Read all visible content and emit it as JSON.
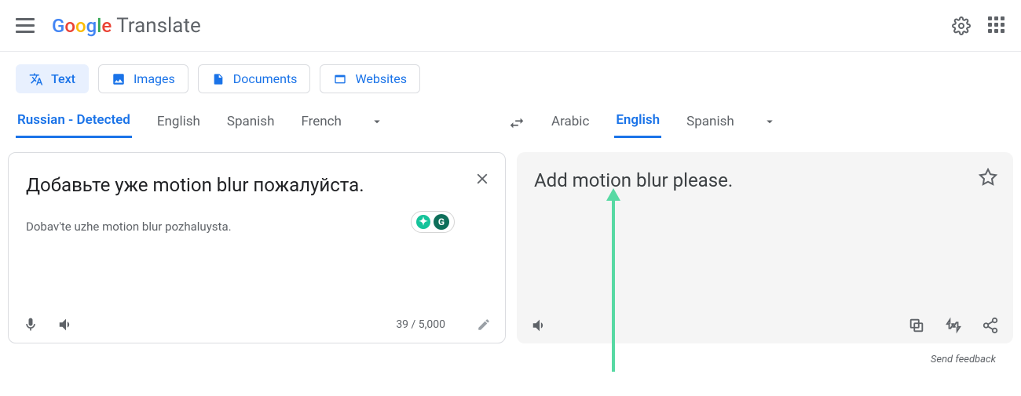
{
  "header": {
    "logo_translate": "Translate"
  },
  "modes": {
    "text": "Text",
    "images": "Images",
    "documents": "Documents",
    "websites": "Websites"
  },
  "source_langs": {
    "detected": "Russian - Detected",
    "english": "English",
    "spanish": "Spanish",
    "french": "French"
  },
  "target_langs": {
    "arabic": "Arabic",
    "english": "English",
    "spanish": "Spanish"
  },
  "source": {
    "text": "Добавьте уже motion blur пожалуйста.",
    "translit": "Dobav'te uzhe motion blur pozhaluysta.",
    "counter": "39 / 5,000"
  },
  "target": {
    "text": "Add motion blur please."
  },
  "footer": {
    "feedback": "Send feedback"
  }
}
